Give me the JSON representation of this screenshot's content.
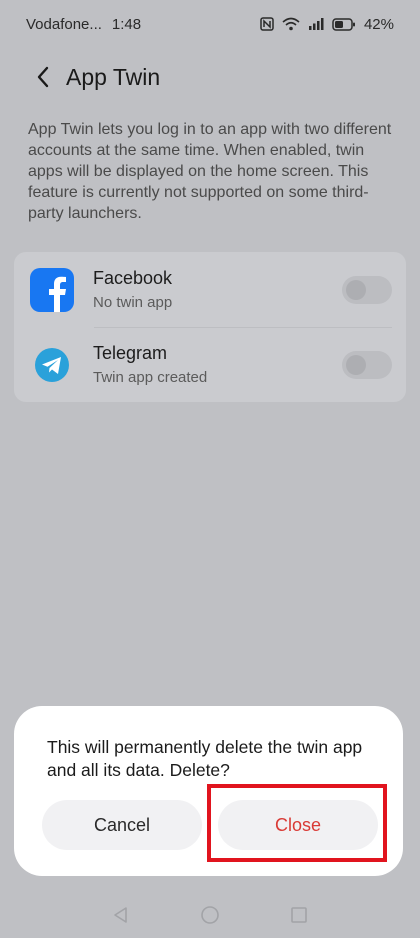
{
  "status_bar": {
    "carrier": "Vodafone...",
    "time": "1:48",
    "battery": "42%",
    "icons": [
      "nfc-icon",
      "wifi-icon",
      "signal-icon",
      "battery-icon"
    ]
  },
  "header": {
    "title": "App Twin",
    "back_icon": "back-chevron-icon"
  },
  "description": "App Twin lets you log in to an app with two different accounts at the same time. When enabled, twin apps will be displayed on the home screen. This feature is currently not supported on some third-party launchers.",
  "apps": [
    {
      "name": "Facebook",
      "status": "No twin app",
      "icon": "facebook-icon",
      "enabled": false
    },
    {
      "name": "Telegram",
      "status": "Twin app created",
      "icon": "telegram-icon",
      "enabled": false
    }
  ],
  "dialog": {
    "message": "This will permanently delete the twin app and all its data. Delete?",
    "cancel_label": "Cancel",
    "confirm_label": "Close"
  },
  "nav_bar": {
    "icons": [
      "nav-back-icon",
      "nav-home-icon",
      "nav-recents-icon"
    ]
  },
  "colors": {
    "background": "#bfc0c4",
    "card": "#cacbcf",
    "dialog": "#ffffff",
    "confirm_text": "#d93a35",
    "highlight": "#e1141e",
    "facebook_blue": "#1877f2",
    "telegram_blue": "#2aa1da"
  }
}
